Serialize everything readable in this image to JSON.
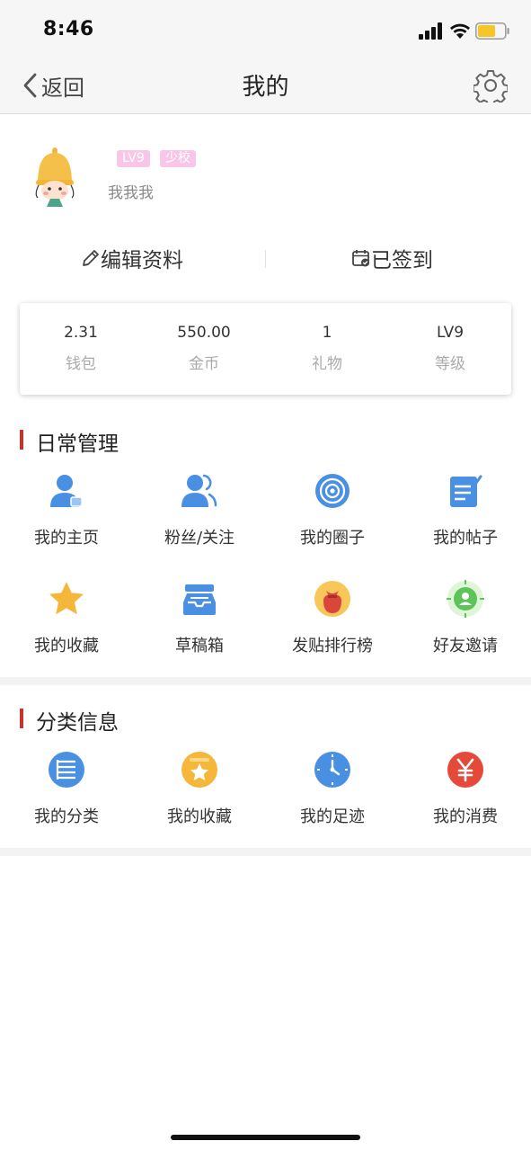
{
  "status_bar": {
    "time": "8:46"
  },
  "nav": {
    "back_label": "返回",
    "title": "我的"
  },
  "profile": {
    "badges": [
      "LV9",
      "少校"
    ],
    "nickname": "我我我",
    "edit_label": "编辑资料",
    "checkin_label": "已签到"
  },
  "stats": [
    {
      "value": "2.31",
      "label": "钱包"
    },
    {
      "value": "550.00",
      "label": "金币"
    },
    {
      "value": "1",
      "label": "礼物"
    },
    {
      "value": "LV9",
      "label": "等级"
    }
  ],
  "daily": {
    "title": "日常管理",
    "items": [
      {
        "label": "我的主页",
        "icon": "user-home-icon"
      },
      {
        "label": "粉丝/关注",
        "icon": "fans-icon"
      },
      {
        "label": "我的圈子",
        "icon": "circle-icon"
      },
      {
        "label": "我的帖子",
        "icon": "posts-icon"
      },
      {
        "label": "我的收藏",
        "icon": "star-icon"
      },
      {
        "label": "草稿箱",
        "icon": "drafts-icon"
      },
      {
        "label": "发贴排行榜",
        "icon": "ranking-icon"
      },
      {
        "label": "好友邀请",
        "icon": "invite-icon"
      }
    ]
  },
  "category": {
    "title": "分类信息",
    "items": [
      {
        "label": "我的分类",
        "icon": "category-icon"
      },
      {
        "label": "我的收藏",
        "icon": "favorite-icon"
      },
      {
        "label": "我的足迹",
        "icon": "history-icon"
      },
      {
        "label": "我的消费",
        "icon": "yuan-icon"
      }
    ]
  },
  "colors": {
    "accent": "#c5342f",
    "badge": "#f7c6e8",
    "icon_blue": "#4a90e2",
    "icon_yellow": "#f5b73a",
    "icon_red": "#e5493a"
  }
}
